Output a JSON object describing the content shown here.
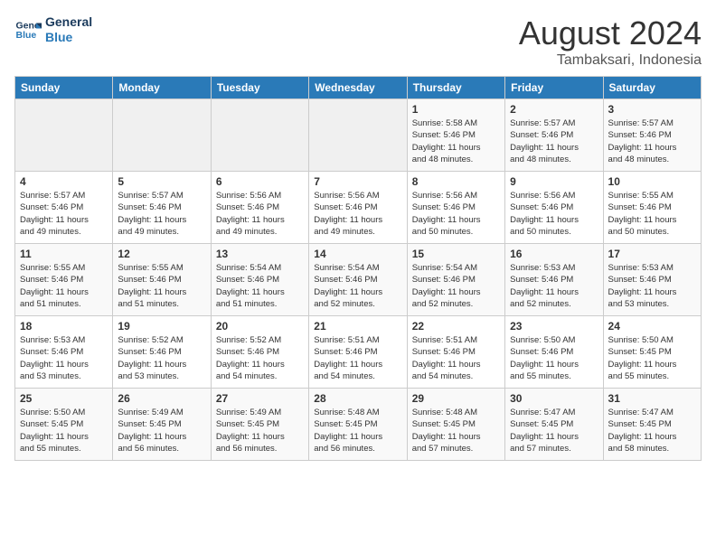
{
  "header": {
    "logo_line1": "General",
    "logo_line2": "Blue",
    "title": "August 2024",
    "subtitle": "Tambaksari, Indonesia"
  },
  "days_of_week": [
    "Sunday",
    "Monday",
    "Tuesday",
    "Wednesday",
    "Thursday",
    "Friday",
    "Saturday"
  ],
  "weeks": [
    [
      {
        "num": "",
        "info": ""
      },
      {
        "num": "",
        "info": ""
      },
      {
        "num": "",
        "info": ""
      },
      {
        "num": "",
        "info": ""
      },
      {
        "num": "1",
        "info": "Sunrise: 5:58 AM\nSunset: 5:46 PM\nDaylight: 11 hours\nand 48 minutes."
      },
      {
        "num": "2",
        "info": "Sunrise: 5:57 AM\nSunset: 5:46 PM\nDaylight: 11 hours\nand 48 minutes."
      },
      {
        "num": "3",
        "info": "Sunrise: 5:57 AM\nSunset: 5:46 PM\nDaylight: 11 hours\nand 48 minutes."
      }
    ],
    [
      {
        "num": "4",
        "info": "Sunrise: 5:57 AM\nSunset: 5:46 PM\nDaylight: 11 hours\nand 49 minutes."
      },
      {
        "num": "5",
        "info": "Sunrise: 5:57 AM\nSunset: 5:46 PM\nDaylight: 11 hours\nand 49 minutes."
      },
      {
        "num": "6",
        "info": "Sunrise: 5:56 AM\nSunset: 5:46 PM\nDaylight: 11 hours\nand 49 minutes."
      },
      {
        "num": "7",
        "info": "Sunrise: 5:56 AM\nSunset: 5:46 PM\nDaylight: 11 hours\nand 49 minutes."
      },
      {
        "num": "8",
        "info": "Sunrise: 5:56 AM\nSunset: 5:46 PM\nDaylight: 11 hours\nand 50 minutes."
      },
      {
        "num": "9",
        "info": "Sunrise: 5:56 AM\nSunset: 5:46 PM\nDaylight: 11 hours\nand 50 minutes."
      },
      {
        "num": "10",
        "info": "Sunrise: 5:55 AM\nSunset: 5:46 PM\nDaylight: 11 hours\nand 50 minutes."
      }
    ],
    [
      {
        "num": "11",
        "info": "Sunrise: 5:55 AM\nSunset: 5:46 PM\nDaylight: 11 hours\nand 51 minutes."
      },
      {
        "num": "12",
        "info": "Sunrise: 5:55 AM\nSunset: 5:46 PM\nDaylight: 11 hours\nand 51 minutes."
      },
      {
        "num": "13",
        "info": "Sunrise: 5:54 AM\nSunset: 5:46 PM\nDaylight: 11 hours\nand 51 minutes."
      },
      {
        "num": "14",
        "info": "Sunrise: 5:54 AM\nSunset: 5:46 PM\nDaylight: 11 hours\nand 52 minutes."
      },
      {
        "num": "15",
        "info": "Sunrise: 5:54 AM\nSunset: 5:46 PM\nDaylight: 11 hours\nand 52 minutes."
      },
      {
        "num": "16",
        "info": "Sunrise: 5:53 AM\nSunset: 5:46 PM\nDaylight: 11 hours\nand 52 minutes."
      },
      {
        "num": "17",
        "info": "Sunrise: 5:53 AM\nSunset: 5:46 PM\nDaylight: 11 hours\nand 53 minutes."
      }
    ],
    [
      {
        "num": "18",
        "info": "Sunrise: 5:53 AM\nSunset: 5:46 PM\nDaylight: 11 hours\nand 53 minutes."
      },
      {
        "num": "19",
        "info": "Sunrise: 5:52 AM\nSunset: 5:46 PM\nDaylight: 11 hours\nand 53 minutes."
      },
      {
        "num": "20",
        "info": "Sunrise: 5:52 AM\nSunset: 5:46 PM\nDaylight: 11 hours\nand 54 minutes."
      },
      {
        "num": "21",
        "info": "Sunrise: 5:51 AM\nSunset: 5:46 PM\nDaylight: 11 hours\nand 54 minutes."
      },
      {
        "num": "22",
        "info": "Sunrise: 5:51 AM\nSunset: 5:46 PM\nDaylight: 11 hours\nand 54 minutes."
      },
      {
        "num": "23",
        "info": "Sunrise: 5:50 AM\nSunset: 5:46 PM\nDaylight: 11 hours\nand 55 minutes."
      },
      {
        "num": "24",
        "info": "Sunrise: 5:50 AM\nSunset: 5:45 PM\nDaylight: 11 hours\nand 55 minutes."
      }
    ],
    [
      {
        "num": "25",
        "info": "Sunrise: 5:50 AM\nSunset: 5:45 PM\nDaylight: 11 hours\nand 55 minutes."
      },
      {
        "num": "26",
        "info": "Sunrise: 5:49 AM\nSunset: 5:45 PM\nDaylight: 11 hours\nand 56 minutes."
      },
      {
        "num": "27",
        "info": "Sunrise: 5:49 AM\nSunset: 5:45 PM\nDaylight: 11 hours\nand 56 minutes."
      },
      {
        "num": "28",
        "info": "Sunrise: 5:48 AM\nSunset: 5:45 PM\nDaylight: 11 hours\nand 56 minutes."
      },
      {
        "num": "29",
        "info": "Sunrise: 5:48 AM\nSunset: 5:45 PM\nDaylight: 11 hours\nand 57 minutes."
      },
      {
        "num": "30",
        "info": "Sunrise: 5:47 AM\nSunset: 5:45 PM\nDaylight: 11 hours\nand 57 minutes."
      },
      {
        "num": "31",
        "info": "Sunrise: 5:47 AM\nSunset: 5:45 PM\nDaylight: 11 hours\nand 58 minutes."
      }
    ]
  ]
}
